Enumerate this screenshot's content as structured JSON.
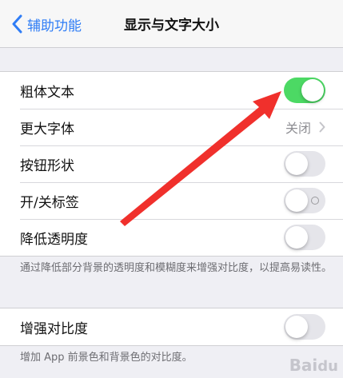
{
  "navbar": {
    "back_label": "辅助功能",
    "title": "显示与文字大小"
  },
  "group1": {
    "rows": [
      {
        "label": "粗体文本",
        "control": "toggle",
        "on": true
      },
      {
        "label": "更大字体",
        "control": "disclosure",
        "value": "关闭"
      },
      {
        "label": "按钮形状",
        "control": "toggle",
        "on": false
      },
      {
        "label": "开/关标签",
        "control": "toggle",
        "on": false
      },
      {
        "label": "降低透明度",
        "control": "toggle",
        "on": false
      }
    ],
    "footnote": "通过降低部分背景的透明度和模糊度来增强对比度，以提高易读性。"
  },
  "group2": {
    "rows": [
      {
        "label": "增强对比度",
        "control": "toggle",
        "on": false
      }
    ],
    "footnote": "增加 App 前景色和背景色的对比度。"
  },
  "colors": {
    "accent": "#2f7df6",
    "toggle_on": "#4cd964",
    "annotation_arrow": "#f0302c"
  },
  "icons": [
    "chevron-left-icon",
    "chevron-right-icon",
    "annotation-arrow-icon"
  ],
  "watermark": "Baidu"
}
